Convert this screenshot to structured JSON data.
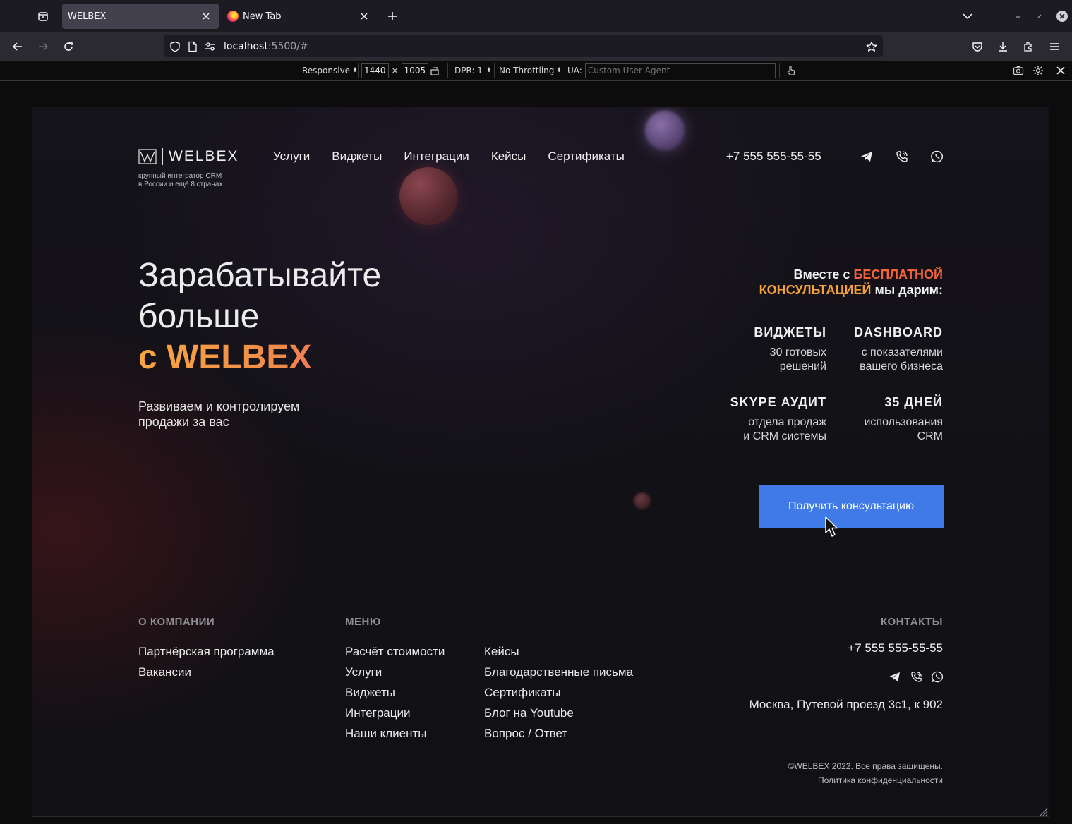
{
  "browser": {
    "tabs": [
      {
        "title": "WELBEX",
        "active": true
      },
      {
        "title": "New Tab",
        "active": false
      }
    ],
    "url": {
      "host": "localhost",
      "rest": ":5500/#"
    },
    "rdm": {
      "device": "Responsive",
      "width": "1440",
      "times": "×",
      "height": "1005",
      "dpr": "DPR: 1",
      "throttling": "No Throttling",
      "ua_label": "UA:",
      "ua_placeholder": "Custom User Agent"
    }
  },
  "site": {
    "logo": {
      "text": "WELBEX",
      "tagline_1": "крупный интегратор CRM",
      "tagline_2": "в России и ещё 8 странах"
    },
    "nav": [
      "Услуги",
      "Виджеты",
      "Интеграции",
      "Кейсы",
      "Сертификаты"
    ],
    "phone": "+7 555 555-55-55",
    "hero": {
      "line1": "Зарабатывайте",
      "line2": "больше",
      "line3": "с WELBEX",
      "subtitle_1": "Развиваем и контролируем",
      "subtitle_2": "продажи за вас"
    },
    "offer": {
      "part1": "Вместе с ",
      "part2": "БЕСПЛАТНОЙ",
      "part3": "КОНСУЛЬТАЦИЕЙ",
      "part4": " мы дарим:"
    },
    "features": [
      {
        "title": "ВИДЖЕТЫ",
        "line1": "30 готовых",
        "line2": "решений"
      },
      {
        "title": "DASHBOARD",
        "line1": "с показателями",
        "line2": "вашего бизнеса"
      },
      {
        "title": "SKYPE АУДИТ",
        "line1": "отдела продаж",
        "line2": "и CRM системы"
      },
      {
        "title": "35 ДНЕЙ",
        "line1": "использования",
        "line2": "CRM"
      }
    ],
    "cta": "Получить консультацию",
    "footer": {
      "about_title": "О КОМПАНИИ",
      "about_items": [
        "Партнёрская программа",
        "Вакансии"
      ],
      "menu_title": "МЕНЮ",
      "menu_col1": [
        "Расчёт стоимости",
        "Услуги",
        "Виджеты",
        "Интеграции",
        "Наши клиенты"
      ],
      "menu_col2": [
        "Кейсы",
        "Благодарственные письма",
        "Сертификаты",
        "Блог на Youtube",
        "Вопрос / Ответ"
      ],
      "contacts_title": "КОНТАКТЫ",
      "phone": "+7 555 555-55-55",
      "address": "Москва, Путевой проезд 3с1, к 902",
      "copyright": "©WELBEX 2022. Все права защищены.",
      "privacy": "Политика конфиденциальности"
    },
    "colors": {
      "accent_blue": "#3f7ae6",
      "accent_orange": "#f6a13b",
      "accent_red": "#f4643c"
    }
  }
}
